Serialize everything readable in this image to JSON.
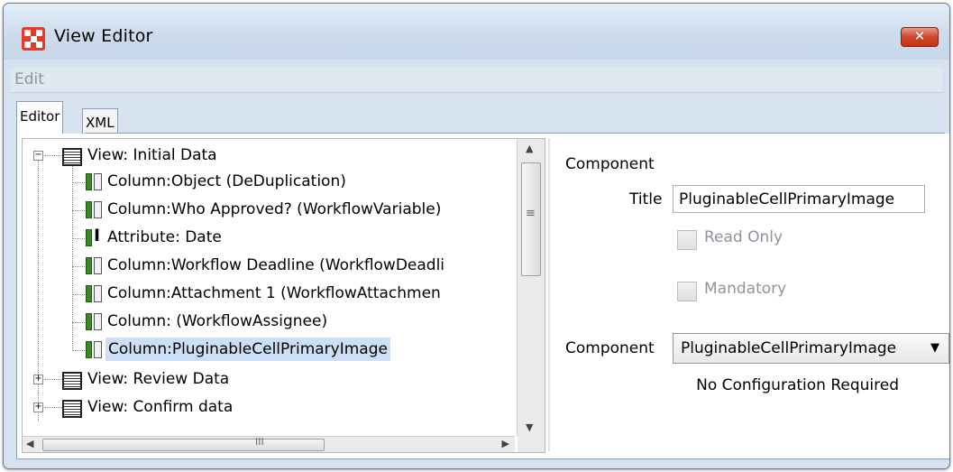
{
  "window": {
    "title": "View Editor",
    "close_label": "✕"
  },
  "menu": {
    "edit": "Edit"
  },
  "tabs": [
    {
      "label": "Editor"
    },
    {
      "label": "XML"
    }
  ],
  "tree": {
    "nodes": [
      {
        "type": "view",
        "label": "View: Initial Data",
        "expanded": true
      },
      {
        "type": "column",
        "label": "Column:Object (DeDuplication)"
      },
      {
        "type": "column",
        "label": "Column:Who Approved? (WorkflowVariable)"
      },
      {
        "type": "attribute",
        "label": "Attribute: Date"
      },
      {
        "type": "column",
        "label": "Column:Workflow Deadline (WorkflowDeadli"
      },
      {
        "type": "column",
        "label": "Column:Attachment 1 (WorkflowAttachmen"
      },
      {
        "type": "column",
        "label": "Column: (WorkflowAssignee)"
      },
      {
        "type": "column",
        "label": "Column:PluginableCellPrimaryImage",
        "selected": true
      },
      {
        "type": "view",
        "label": "View: Review Data",
        "expanded": false
      },
      {
        "type": "view",
        "label": "View: Confirm data",
        "expanded": false
      }
    ],
    "hscroll_grip": "III",
    "vscroll_grip": "≡"
  },
  "form": {
    "section": "Component",
    "title_label": "Title",
    "title_value": "PluginableCellPrimaryImage",
    "read_only_label": "Read Only",
    "mandatory_label": "Mandatory",
    "component_label": "Component",
    "component_value": "PluginableCellPrimaryImage",
    "note": "No Configuration Required"
  },
  "icons": {
    "app": "app-grid-icon",
    "close": "close-icon",
    "view": "view-list-icon",
    "column": "column-icon",
    "attribute": "attribute-icon",
    "caret": "chevron-down-icon"
  },
  "colors": {
    "title_bg": "#cddbec",
    "selection": "#cddff4",
    "close_btn": "#c23418",
    "app_icon": "#e53a2a",
    "column_icon": "#3a8a24"
  }
}
